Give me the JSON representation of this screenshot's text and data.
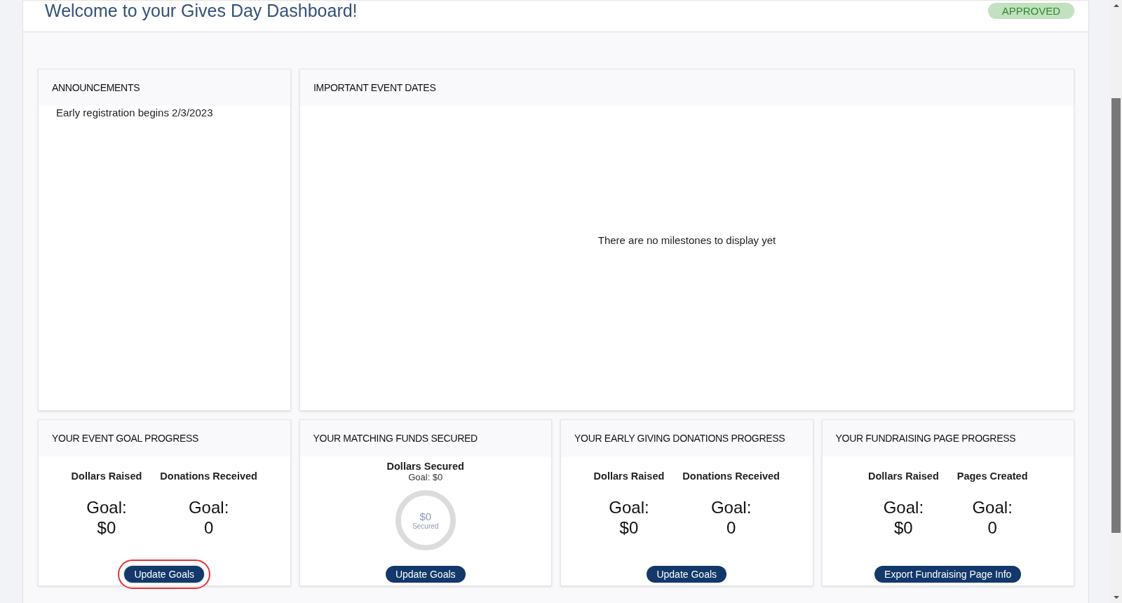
{
  "header": {
    "title": "Welcome to your Gives Day Dashboard!",
    "status": "APPROVED"
  },
  "announcements": {
    "title": "ANNOUNCEMENTS",
    "items": [
      "Early registration begins 2/3/2023"
    ]
  },
  "event_dates": {
    "title": "IMPORTANT EVENT DATES",
    "empty_message": "There are no milestones to display yet"
  },
  "progress_cards": [
    {
      "kind": "stats",
      "title": "YOUR EVENT GOAL PROGRESS",
      "stats": [
        {
          "label": "Dollars Raised",
          "goal_label": "Goal:",
          "goal": "$0"
        },
        {
          "label": "Donations Received",
          "goal_label": "Goal:",
          "goal": "0"
        }
      ],
      "button": {
        "label": "Update Goals",
        "highlighted": true
      }
    },
    {
      "kind": "ring",
      "title": "YOUR MATCHING FUNDS SECURED",
      "heading": "Dollars Secured",
      "subheading": "Goal: $0",
      "ring_value": "$0",
      "ring_caption": "Secured",
      "level": 0,
      "button": {
        "label": "Update Goals",
        "highlighted": false
      }
    },
    {
      "kind": "stats",
      "title": "YOUR EARLY GIVING DONATIONS PROGRESS",
      "stats": [
        {
          "label": "Dollars Raised",
          "goal_label": "Goal:",
          "goal": "$0"
        },
        {
          "label": "Donations Received",
          "goal_label": "Goal:",
          "goal": "0"
        }
      ],
      "button": {
        "label": "Update Goals",
        "highlighted": false
      }
    },
    {
      "kind": "stats",
      "title": "YOUR FUNDRAISING PAGE PROGRESS",
      "stats": [
        {
          "label": "Dollars Raised",
          "goal_label": "Goal:",
          "goal": "$0"
        },
        {
          "label": "Pages Created",
          "goal_label": "Goal:",
          "goal": "0"
        }
      ],
      "button": {
        "label": "Export Fundraising Page Info",
        "highlighted": false
      }
    }
  ]
}
